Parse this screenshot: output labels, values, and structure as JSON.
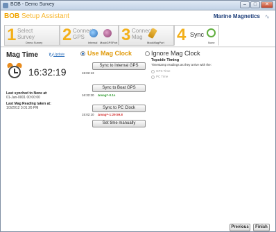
{
  "window": {
    "title": "BOB - Demo Survey"
  },
  "header": {
    "app_title_bold": "BOB",
    "app_title_rest": " Setup Assistant",
    "brand": "Marine Magnetics"
  },
  "steps": [
    {
      "number": "1",
      "label_line1": "Select",
      "label_line2": "Survey",
      "sub": "Demo Survey"
    },
    {
      "number": "2",
      "label_line1": "Connect",
      "label_line2": "GPS",
      "sub1": "Internal",
      "sub2": "MockGPSPort"
    },
    {
      "number": "3",
      "label_line1": "Connect",
      "label_line2": "Mag",
      "sub": "MockMagPort"
    },
    {
      "number": "4",
      "label_line1": "Sync",
      "sub": "None"
    }
  ],
  "mag_time": {
    "heading": "Mag Time",
    "update_label": "Update",
    "time": "16:32:19",
    "last_synced_label": "Last synched to None at:",
    "last_synced_value": "01-Jan-0001 00:00:00",
    "last_reading_label": "Last Mag Reading taken at:",
    "last_reading_value": "1/3/2012 3:01:26 PM"
  },
  "use_mag_clock": {
    "label": "Use Mag Clock",
    "selected": true,
    "sync_internal_gps": {
      "button": "Sync to Internal GPS",
      "time": "15:02:13"
    },
    "sync_boat_gps": {
      "button": "Sync to Boat GPS",
      "time": "16:32:20",
      "delta": "Δmag=-0.1s"
    },
    "sync_pc_clock": {
      "button": "Sync to PC Clock",
      "time": "15:02:10",
      "delta": "Δmag=-1:29:59.8"
    },
    "set_manually": {
      "button": "Set time manually"
    }
  },
  "ignore_mag_clock": {
    "label": "Ignore Mag Clock",
    "selected": false,
    "topside_title": "Topside Timing",
    "topside_desc": "Timestamp readings as they arrive with the:",
    "options": [
      "GPS Time",
      "PC Time"
    ]
  },
  "footer": {
    "previous": "Previous",
    "finish": "Finish"
  }
}
